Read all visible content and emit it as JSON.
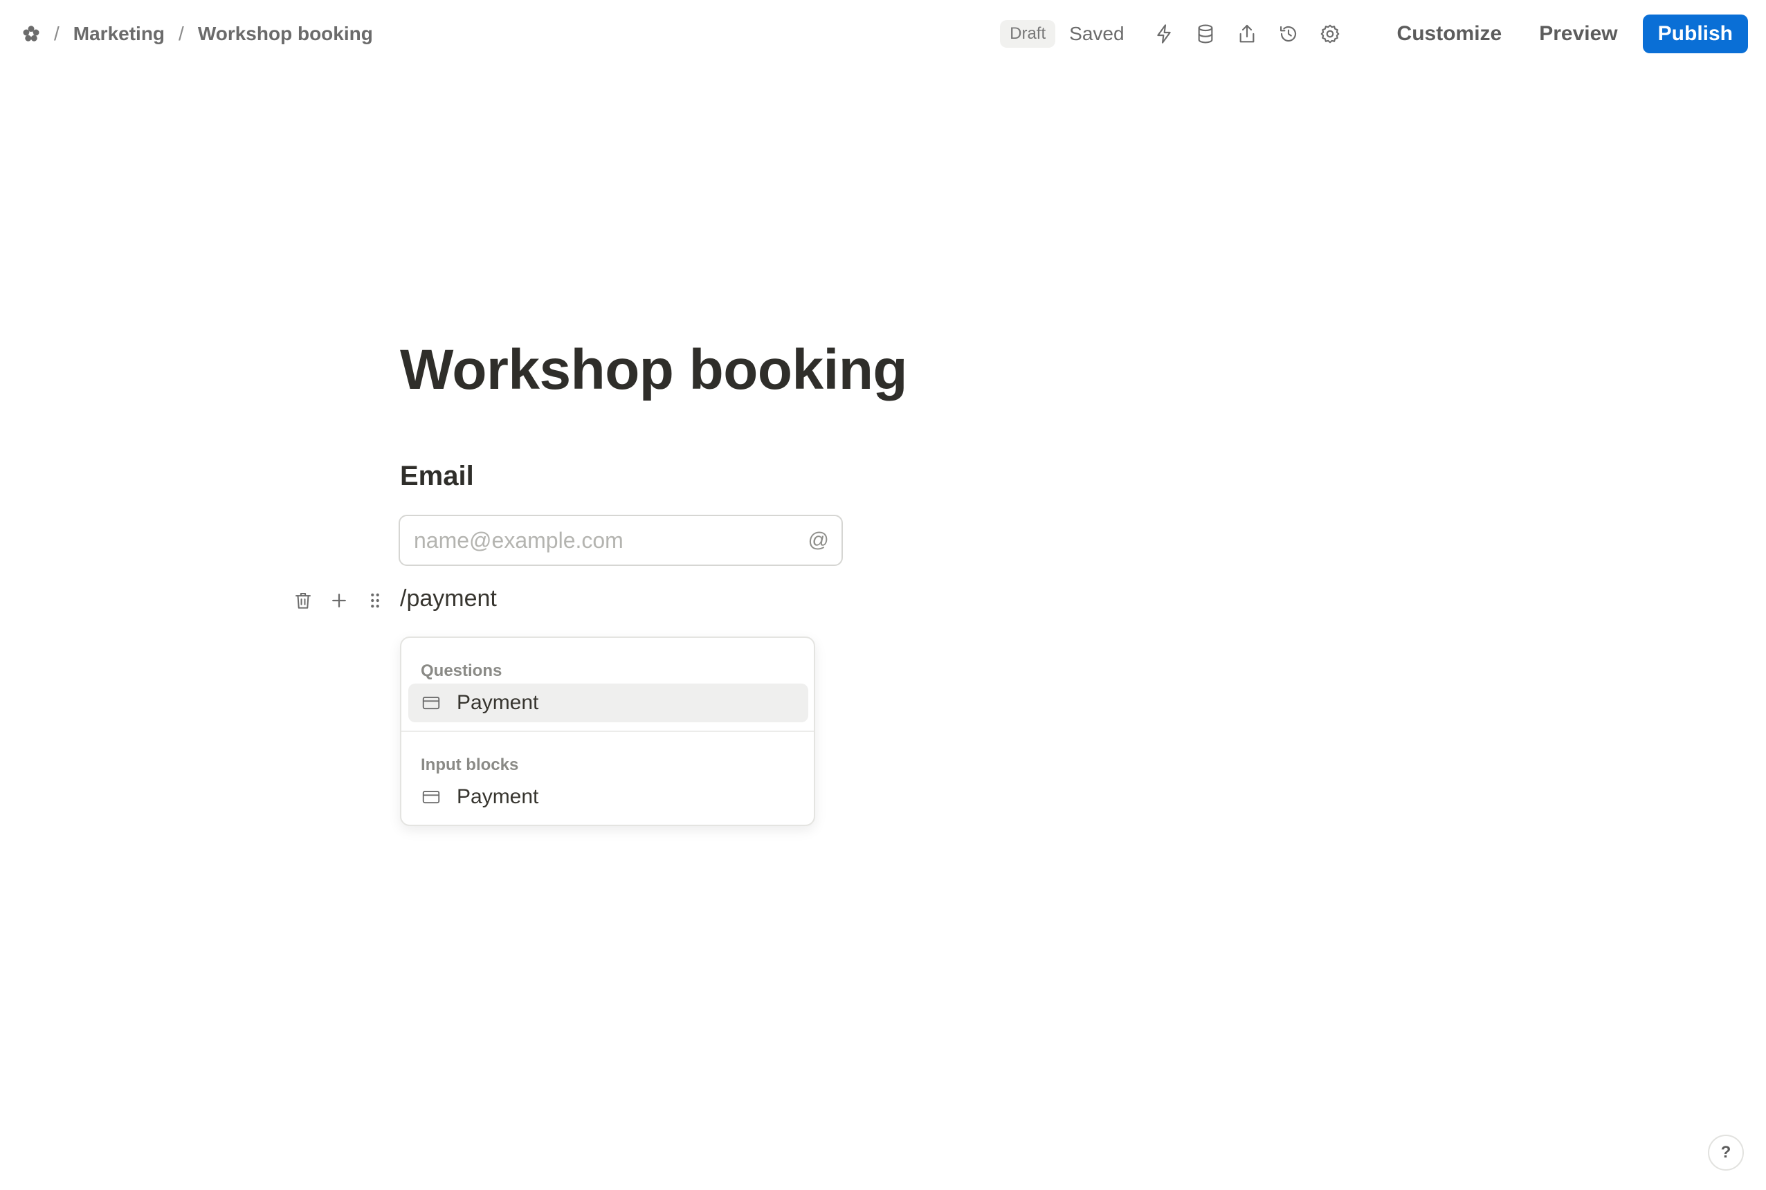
{
  "breadcrumb": {
    "separator": "/",
    "items": [
      "Marketing",
      "Workshop booking"
    ]
  },
  "header": {
    "status_badge": "Draft",
    "save_status": "Saved",
    "icons": [
      "bolt-icon",
      "database-icon",
      "share-icon",
      "history-icon",
      "gear-icon"
    ],
    "customize_label": "Customize",
    "preview_label": "Preview",
    "publish_label": "Publish"
  },
  "form": {
    "title": "Workshop booking",
    "email_question": {
      "label": "Email",
      "placeholder": "name@example.com",
      "icon": "@"
    },
    "slash_command": "/payment"
  },
  "menu": {
    "groups": [
      {
        "title": "Questions",
        "items": [
          {
            "label": "Payment",
            "icon": "card-icon"
          }
        ]
      },
      {
        "title": "Input blocks",
        "items": [
          {
            "label": "Payment",
            "icon": "card-icon"
          }
        ]
      }
    ]
  },
  "help_label": "?",
  "colors": {
    "accent": "#0a6fd6",
    "text": "#37352f",
    "muted": "#6b6b6b",
    "highlight": "#efefee"
  }
}
